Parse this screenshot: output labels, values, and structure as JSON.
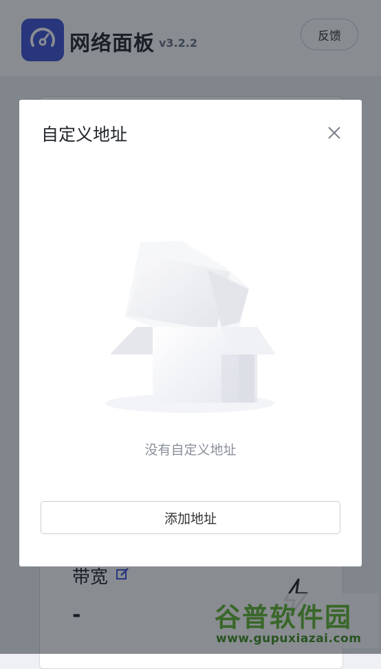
{
  "header": {
    "app_name": "网络面板",
    "version": "v3.2.2",
    "feedback_label": "反馈",
    "logo_icon": "speedometer-icon",
    "brand_color": "#3d52d5"
  },
  "card": {
    "bandwidth_label": "带宽",
    "bandwidth_value": "-",
    "edit_icon": "edit-icon",
    "speed_icon": "bolt-icon"
  },
  "dialog": {
    "title": "自定义地址",
    "close_icon": "close-icon",
    "empty_text": "没有自定义地址",
    "empty_icon": "empty-box-icon",
    "add_button_label": "添加地址"
  },
  "watermark": {
    "name": "谷普软件园",
    "url": "www.gupuxiazai.com"
  }
}
